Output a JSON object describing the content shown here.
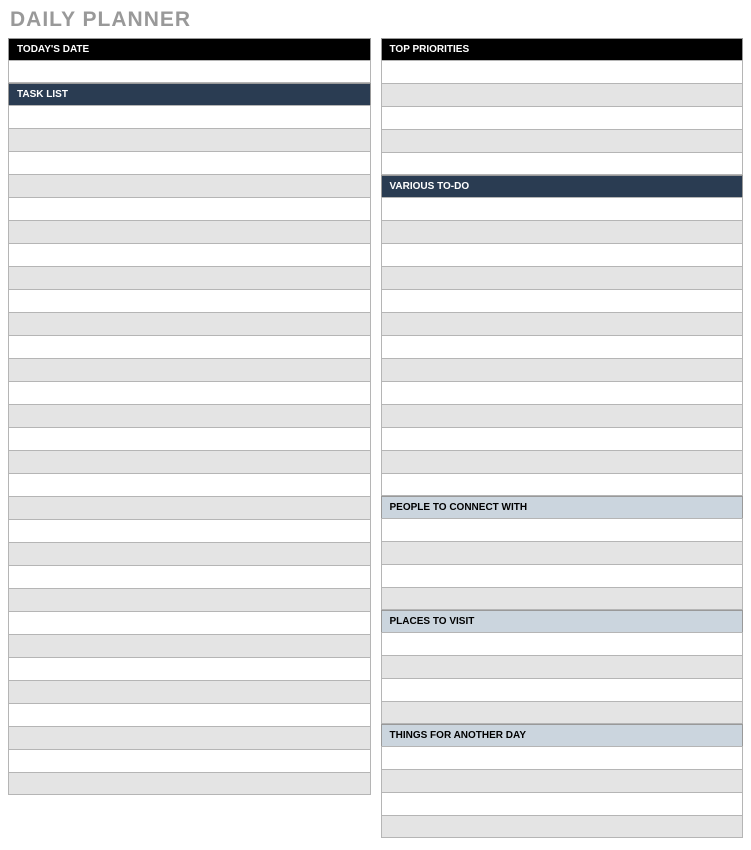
{
  "title": "DAILY PLANNER",
  "left": {
    "todays_date_header": "TODAY'S DATE",
    "task_list_header": "TASK LIST"
  },
  "right": {
    "top_priorities_header": "TOP PRIORITIES",
    "various_todo_header": "VARIOUS TO-DO",
    "people_to_connect_header": "PEOPLE TO CONNECT WITH",
    "places_to_visit_header": "PLACES TO VISIT",
    "things_another_day_header": "THINGS FOR ANOTHER DAY"
  }
}
